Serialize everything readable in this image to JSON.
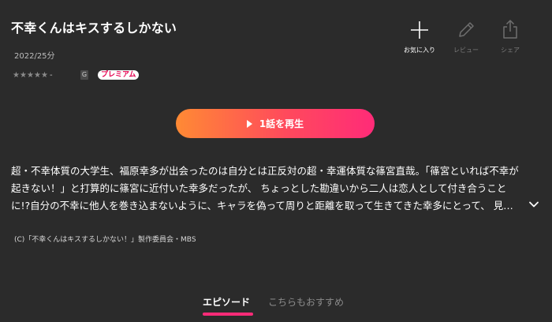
{
  "title": "不幸くんはキスするしかない",
  "meta": "2022/25分",
  "rating": {
    "star_count": 5,
    "star_glyph": "★",
    "value_text": "-"
  },
  "badges": {
    "age": "G",
    "premium": "プレミアム"
  },
  "actions": {
    "favorite": "お気に入り",
    "review": "レビュー",
    "share": "シェア"
  },
  "play_button": "1話を再生",
  "description": [
    "超・不幸体質の大学生、福原幸多が出会ったのは自分とは正反対の超・幸運体質な篠宮直哉。「篠宮といれば不幸が",
    "起きない！」と打算的に篠宮に近付いた幸多だったが、 ちょっとした勘違いから二人は恋人として付き合うこと",
    "に!?自分の不幸に他人を巻き込まないように、キャラを偽って周りと距離を取って生きてきた幸多にとって、 見…"
  ],
  "copyright": "(C)「不幸くんはキスするしかない！」製作委員会・MBS",
  "tabs": {
    "episodes": "エピソード",
    "recommended": "こちらもおすすめ"
  },
  "colors": {
    "background": "#2b2b2b",
    "accent": "#ff2b78",
    "gradient_start": "#ff8a34",
    "premium_text": "#e4004f"
  },
  "icons": {
    "favorite": "plus-icon",
    "review": "pencil-icon",
    "share": "share-icon",
    "expand": "chevron-down-icon",
    "play": "play-icon"
  }
}
